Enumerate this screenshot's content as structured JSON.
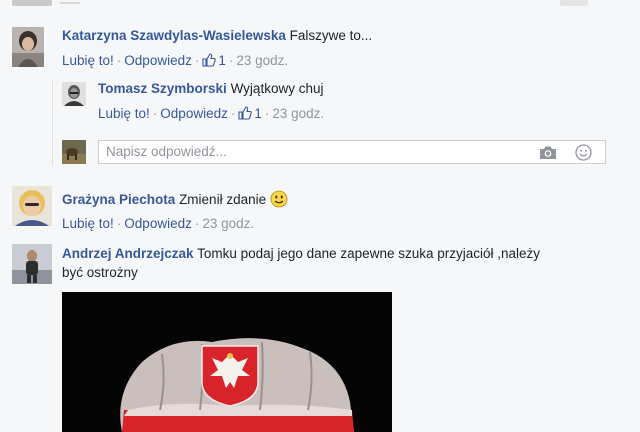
{
  "comments": [
    {
      "author": "Katarzyna Szawdylas-Wasielewska",
      "text": "Falszywe to...",
      "like": "Lubię to!",
      "reply": "Odpowiedz",
      "likes": "1",
      "time": "23 godz."
    },
    {
      "author": "Tomasz Szymborski",
      "text": "Wyjątkowy chuj",
      "like": "Lubię to!",
      "reply": "Odpowiedz",
      "likes": "1",
      "time": "23 godz."
    },
    {
      "author": "Grażyna Piechota",
      "text": "Zmienił zdanie",
      "like": "Lubię to!",
      "reply": "Odpowiedz",
      "time": "23 godz."
    },
    {
      "author": "Andrzej Andrzejczak",
      "text_line1": "Tomku podaj jego dane zapewne szuka przyjaciół ,należy",
      "text_line2": "być ostrożny"
    }
  ],
  "reply_box": {
    "placeholder": "Napisz odpowiedź..."
  },
  "icons": {
    "like": "thumbs-up-icon",
    "camera": "camera-icon",
    "emoji": "smiley-icon"
  },
  "colors": {
    "link": "#365899",
    "meta": "#90949c",
    "background": "#f6f7f9"
  }
}
